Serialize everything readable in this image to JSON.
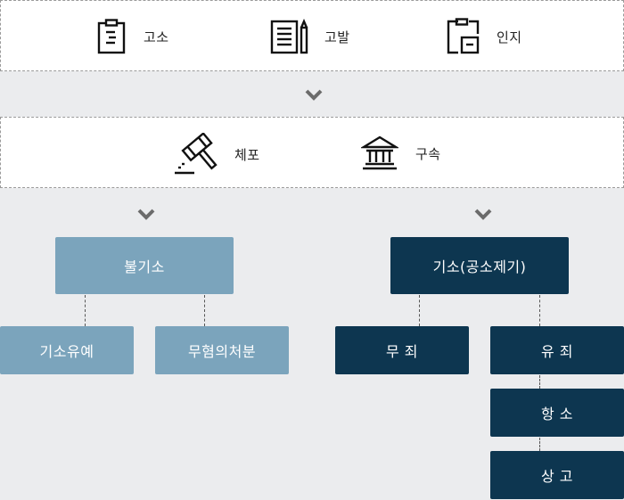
{
  "top_row": {
    "items": [
      {
        "label": "고소",
        "icon": "clipboard-icon"
      },
      {
        "label": "고발",
        "icon": "document-pen-icon"
      },
      {
        "label": "인지",
        "icon": "clipboard-box-icon"
      }
    ]
  },
  "middle_row": {
    "items": [
      {
        "label": "체포",
        "icon": "gavel-icon"
      },
      {
        "label": "구속",
        "icon": "courthouse-icon"
      }
    ]
  },
  "branches": {
    "non_indictment": {
      "label": "불기소",
      "children": [
        "기소유예",
        "무혐의처분"
      ]
    },
    "indictment": {
      "label": "기소(공소제기)",
      "children": [
        "무 죄",
        "유 죄"
      ],
      "chain": [
        "항 소",
        "상 고"
      ]
    }
  },
  "colors": {
    "light": "#7ba4bc",
    "dark": "#0d3650",
    "background": "#ebecee"
  }
}
